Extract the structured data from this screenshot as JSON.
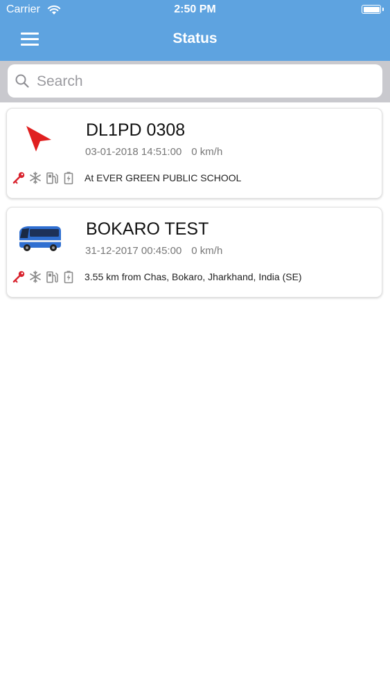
{
  "status_bar": {
    "carrier": "Carrier",
    "time": "2:50 PM"
  },
  "header": {
    "title": "Status",
    "menu_icon": "hamburger-menu-icon",
    "background": "#5ea3e0"
  },
  "search": {
    "placeholder": "Search",
    "value": ""
  },
  "vehicles": [
    {
      "name": "DL1PD 0308",
      "datetime": "03-01-2018 14:51:00",
      "speed": "0 km/h",
      "location": "At EVER GREEN PUBLIC SCHOOL",
      "icon": "red-navigation-arrow-icon"
    },
    {
      "name": "BOKARO TEST",
      "datetime": "31-12-2017 00:45:00",
      "speed": "0 km/h",
      "location": "3.55 km from Chas, Bokaro, Jharkhand, India (SE)",
      "icon": "blue-bus-icon"
    }
  ],
  "indicator_icons": [
    "ignition-key-icon",
    "ac-snowflake-icon",
    "fuel-pump-icon",
    "battery-icon"
  ],
  "colors": {
    "ignition": "#d9232e",
    "indicator_gray": "#8a8a8a",
    "arrow": "#e02020",
    "bus": "#2f6fd1"
  }
}
